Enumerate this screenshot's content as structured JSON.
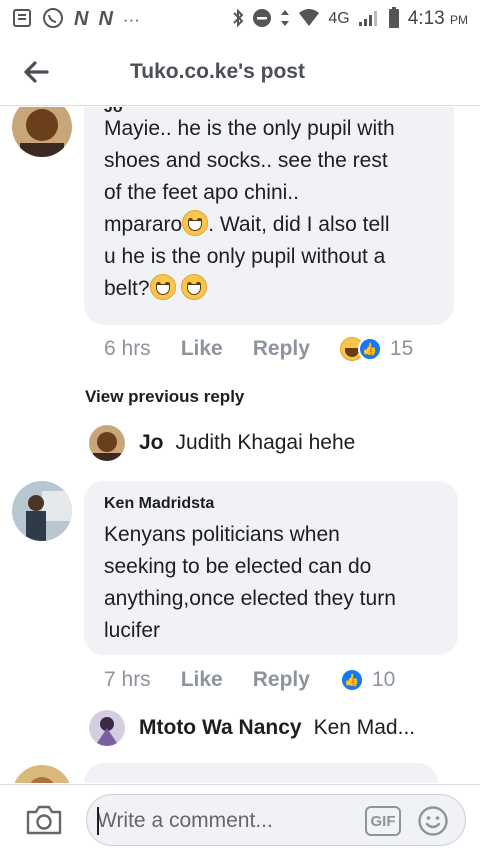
{
  "status_bar": {
    "network": "4G",
    "time": "4:13",
    "ampm": "PM"
  },
  "header": {
    "title": "Tuko.co.ke's post"
  },
  "comments": [
    {
      "name": "Jo",
      "text_lines": [
        "Mayie.. he is the only pupil with",
        "shoes and socks.. see the rest",
        "of the feet apo chini..",
        "mpararo",
        ". Wait, did I also tell",
        "u he is the only pupil without a",
        "belt?"
      ],
      "time": "6 hrs",
      "like": "Like",
      "reply": "Reply",
      "reaction_count": "15"
    },
    {
      "name": "Ken Madridsta",
      "text_lines": [
        "Kenyans politicians when",
        "seeking to be elected can do",
        "anything,once elected they turn",
        "lucifer"
      ],
      "time": "7 hrs",
      "like": "Like",
      "reply": "Reply",
      "reaction_count": "10"
    }
  ],
  "view_previous_reply": "View previous reply",
  "replies": [
    {
      "name": "Jo",
      "text": "Judith Khagai hehe"
    },
    {
      "name": "Mtoto Wa Nancy",
      "text": "Ken Mad..."
    }
  ],
  "composer": {
    "placeholder": "Write a comment...",
    "gif_label": "GIF"
  }
}
